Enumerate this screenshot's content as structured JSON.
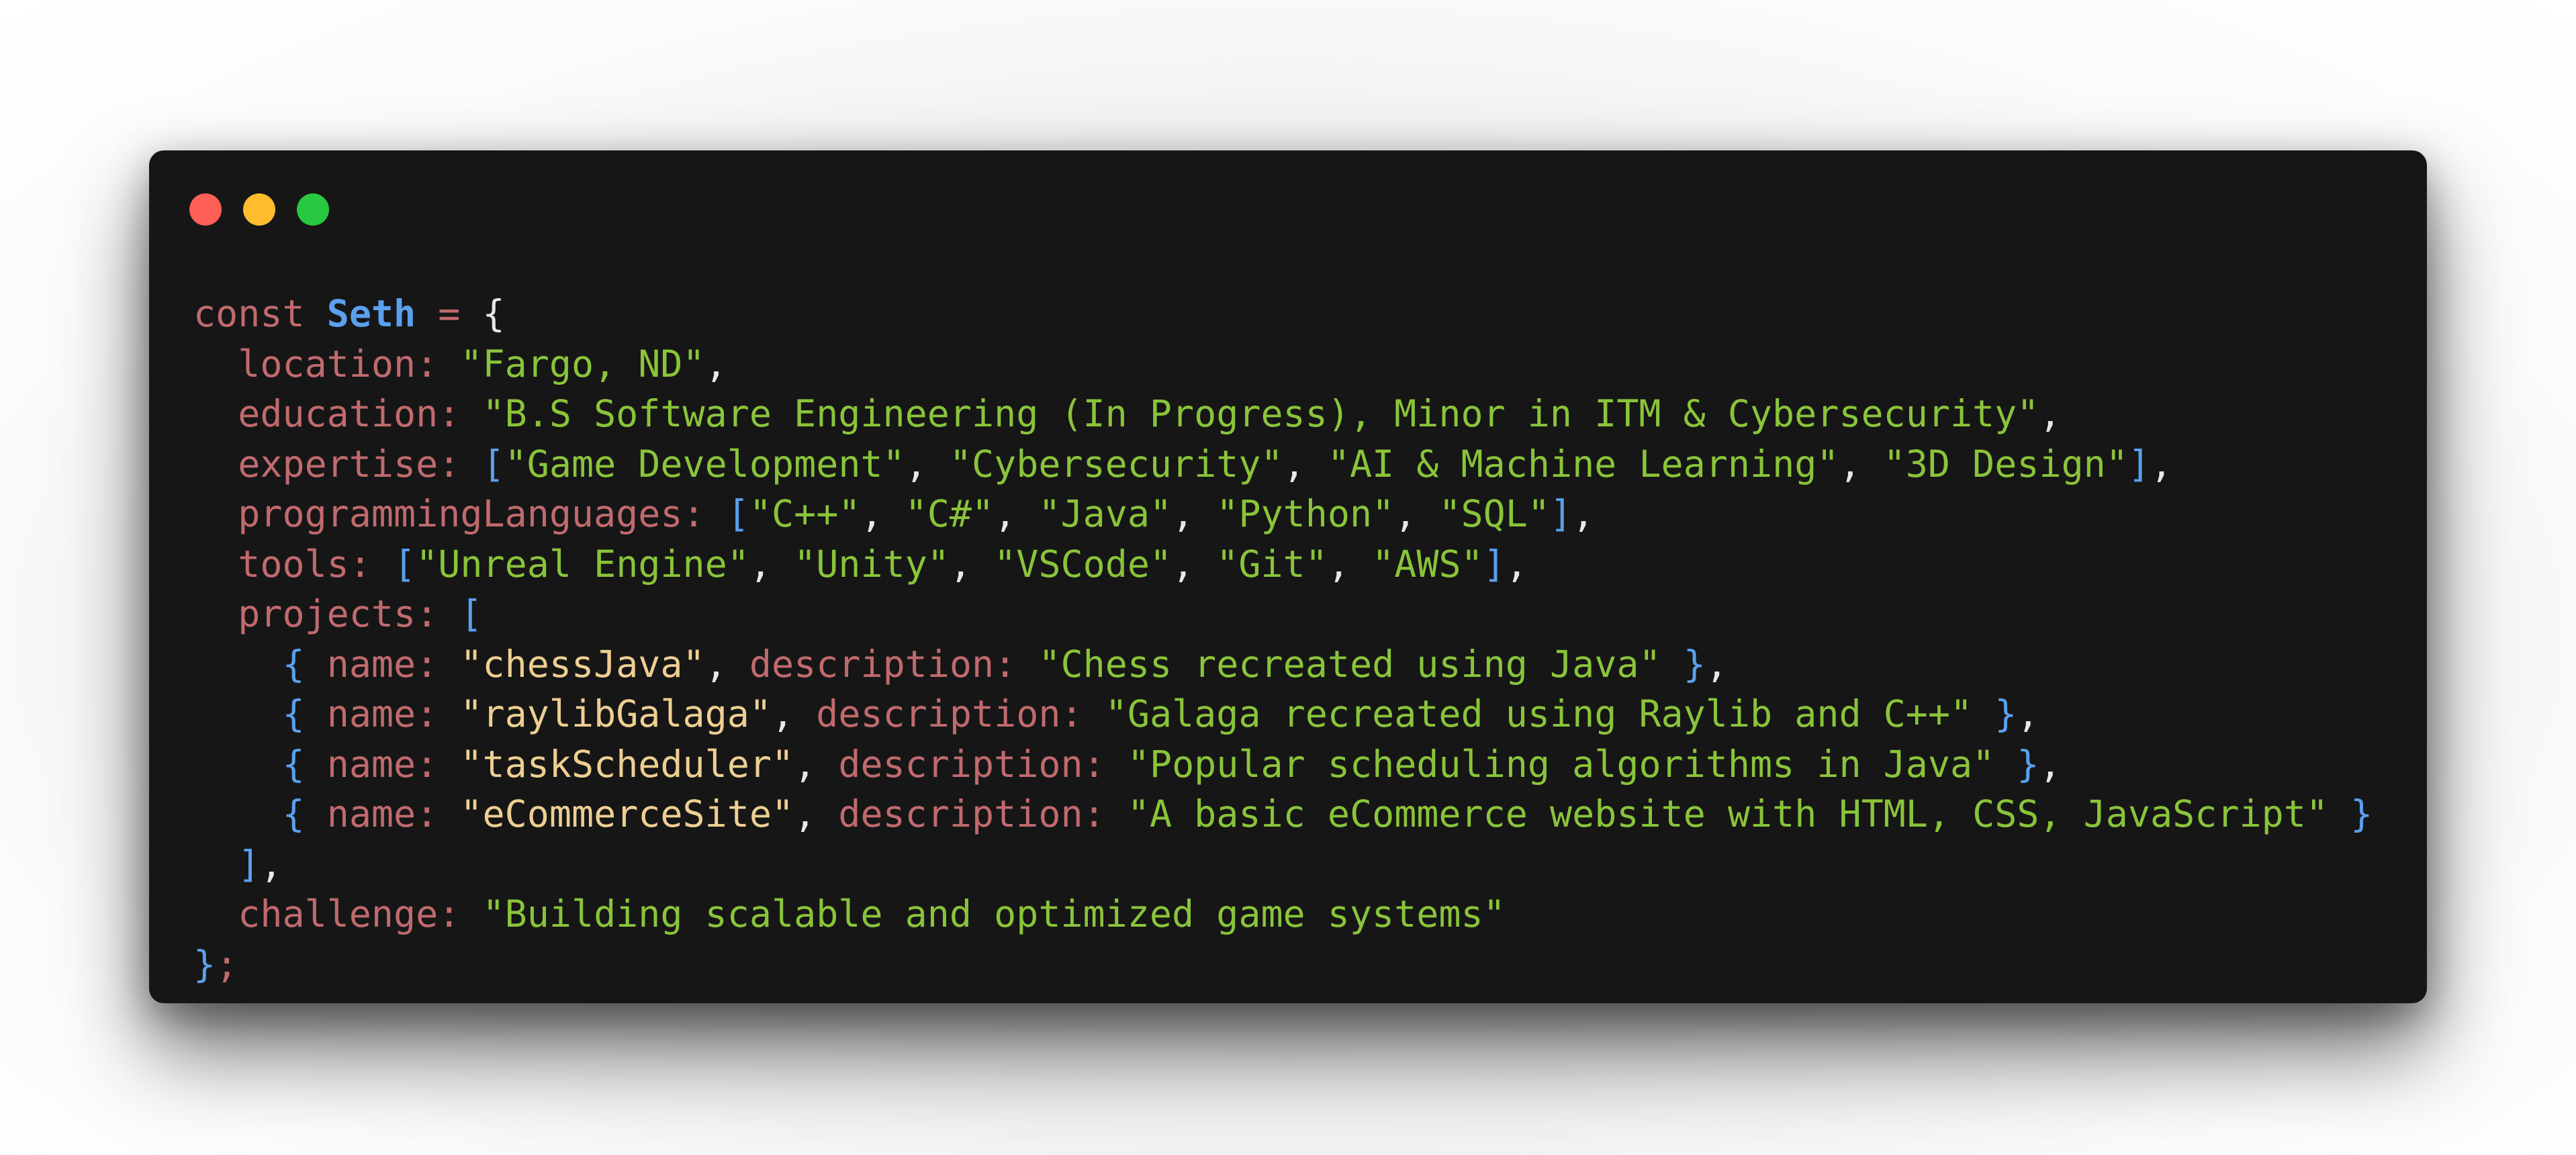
{
  "window": {
    "buttons": [
      {
        "name": "close",
        "color": "#fe5f57"
      },
      {
        "name": "minimize",
        "color": "#febc2e"
      },
      {
        "name": "maximize",
        "color": "#28c840"
      }
    ]
  },
  "code": {
    "keyword": "const",
    "identifier": "Seth",
    "location_key": "location",
    "location": "\"Fargo, ND\"",
    "education_key": "education",
    "education": "\"B.S Software Engineering (In Progress), Minor in ITM & Cybersecurity\"",
    "expertise_key": "expertise",
    "expertise": [
      "\"Game Development\"",
      "\"Cybersecurity\"",
      "\"AI & Machine Learning\"",
      "\"3D Design\""
    ],
    "languages_key": "programmingLanguages",
    "languages": [
      "\"C++\"",
      "\"C#\"",
      "\"Java\"",
      "\"Python\"",
      "\"SQL\""
    ],
    "tools_key": "tools",
    "tools": [
      "\"Unreal Engine\"",
      "\"Unity\"",
      "\"VSCode\"",
      "\"Git\"",
      "\"AWS\""
    ],
    "projects_key": "projects",
    "name_key": "name",
    "description_key": "description",
    "projects": [
      {
        "name": "\"chessJava\"",
        "description": "\"Chess recreated using Java\""
      },
      {
        "name": "\"raylibGalaga\"",
        "description": "\"Galaga recreated using Raylib and C++\""
      },
      {
        "name": "\"taskScheduler\"",
        "description": "\"Popular scheduling algorithms in Java\""
      },
      {
        "name": "\"eCommerceSite\"",
        "description": "\"A basic eCommerce website with HTML, CSS, JavaScript\""
      }
    ],
    "challenge_key": "challenge",
    "challenge": "\"Building scalable and optimized game systems\""
  }
}
